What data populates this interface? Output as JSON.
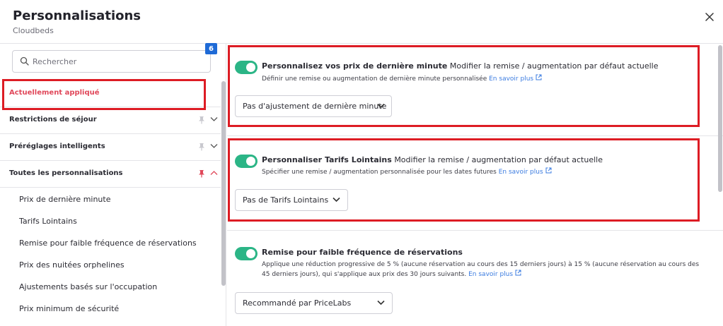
{
  "header": {
    "title": "Personnalisations",
    "subtitle": "Cloudbeds"
  },
  "sidebar": {
    "search_placeholder": "Rechercher",
    "applied": {
      "label": "Actuellement appliqué",
      "count": "6"
    },
    "categories": [
      {
        "label": "Restrictions de séjour",
        "pinned": false,
        "expanded": false
      },
      {
        "label": "Préréglages intelligents",
        "pinned": false,
        "expanded": false
      },
      {
        "label": "Toutes les personnalisations",
        "pinned": true,
        "expanded": true
      }
    ],
    "items": [
      "Prix de dernière minute",
      "Tarifs Lointains",
      "Remise pour faible fréquence de réservations",
      "Prix des nuitées orphelines",
      "Ajustements basés sur l'occupation",
      "Prix minimum de sécurité"
    ]
  },
  "sections": [
    {
      "title": "Personnalisez vos prix de dernière minute",
      "subtitle": "Modifier la remise / augmentation par défaut actuelle",
      "description": "Définir une remise ou augmentation de dernière minute personnalisée",
      "link": "En savoir plus",
      "dropdown_value": "Pas d'ajustement de dernière minute",
      "enabled": true
    },
    {
      "title": "Personnaliser Tarifs Lointains",
      "subtitle": "Modifier la remise / augmentation par défaut actuelle",
      "description": "Spécifier une remise / augmentation personnalisée pour les dates futures",
      "link": "En savoir plus",
      "dropdown_value": "Pas de Tarifs Lointains",
      "enabled": true
    },
    {
      "title": "Remise pour faible fréquence de réservations",
      "subtitle": "",
      "description": "Applique une réduction progressive de 5 % (aucune réservation au cours des 15 derniers jours) à 15 % (aucune réservation au cours des 45 derniers jours), qui s'applique aux prix des 30 jours suivants.",
      "link": "En savoir plus",
      "dropdown_value": "Recommandé par PriceLabs",
      "enabled": true
    }
  ],
  "colors": {
    "toggle_on": "#2bb586",
    "accent_red": "#e0485a",
    "badge_blue": "#1e6ad6",
    "link_blue": "#3a7be0",
    "highlight": "#dd1c24"
  }
}
